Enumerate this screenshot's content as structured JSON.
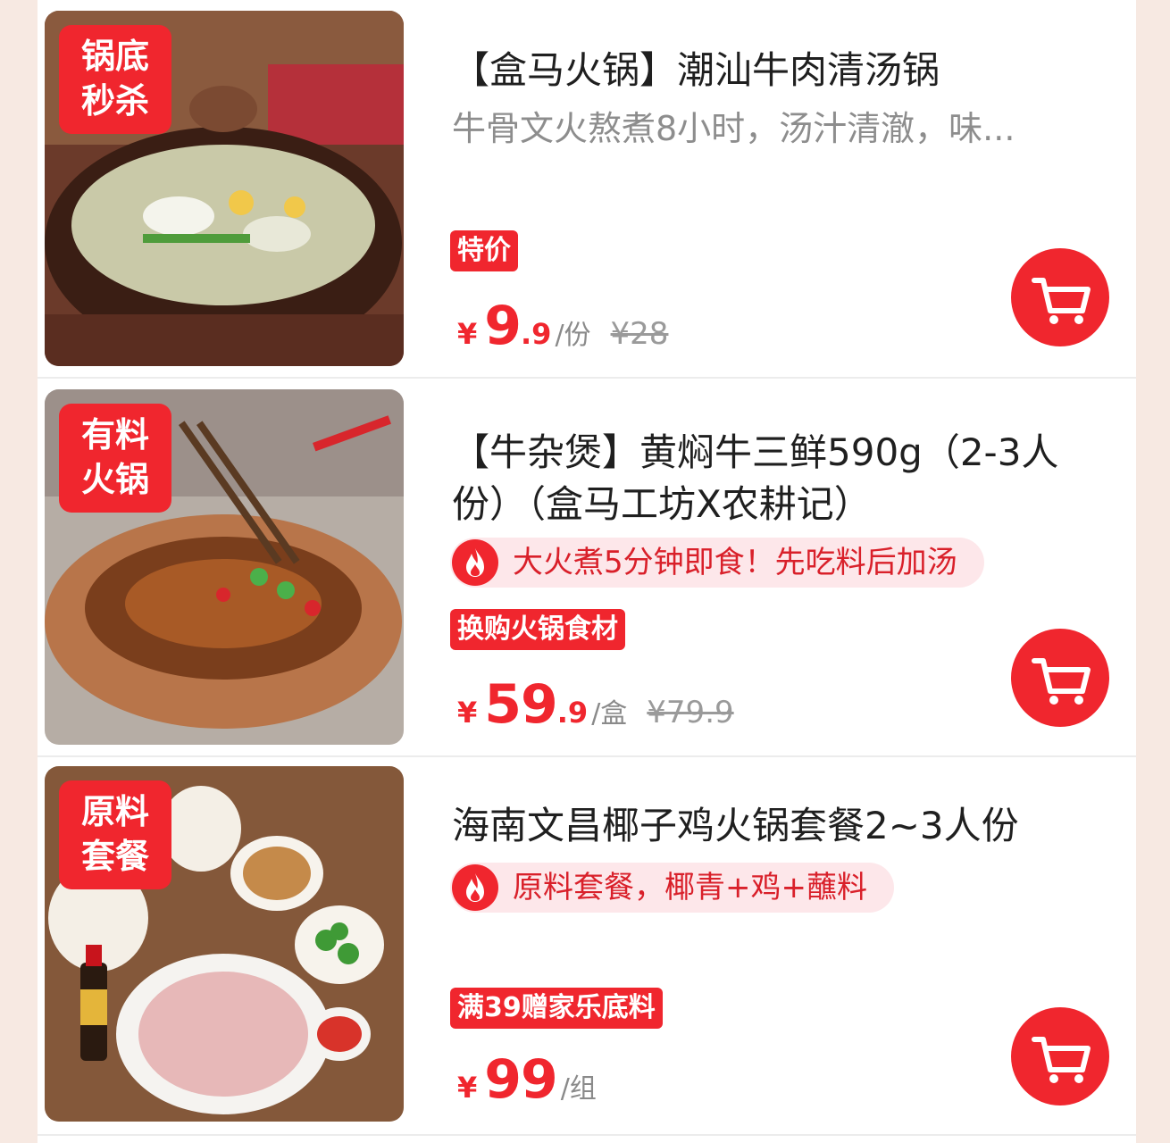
{
  "products": [
    {
      "tag_line1": "锅底",
      "tag_line2": "秒杀",
      "title": "【盒马火锅】潮汕牛肉清汤锅",
      "subtitle": "牛骨文火熬煮8小时，汤汁清澈，味...",
      "promo": "特价",
      "currency": "¥",
      "price_int": "9",
      "price_dec": ".9",
      "unit": "/份",
      "original_price": "¥28"
    },
    {
      "tag_line1": "有料",
      "tag_line2": "火锅",
      "title": "【牛杂煲】黄焖牛三鲜590g（2-3人份）（盒马工坊X农耕记）",
      "hint": "大火煮5分钟即食！先吃料后加汤",
      "promo": "换购火锅食材",
      "currency": "¥",
      "price_int": "59",
      "price_dec": ".9",
      "unit": "/盒",
      "original_price": "¥79.9"
    },
    {
      "tag_line1": "原料",
      "tag_line2": "套餐",
      "title": "海南文昌椰子鸡火锅套餐2~3人份",
      "hint": "原料套餐，椰青+鸡+蘸料",
      "promo": "满39赠家乐底料",
      "currency": "¥",
      "price_int": "99",
      "unit": "/组"
    }
  ],
  "icons": {
    "cart": "shopping-cart-icon",
    "hint": "flame-icon"
  },
  "colors": {
    "accent": "#f0262e",
    "hint_bg": "#fde7ea",
    "page_bg": "#f7e9e2"
  }
}
